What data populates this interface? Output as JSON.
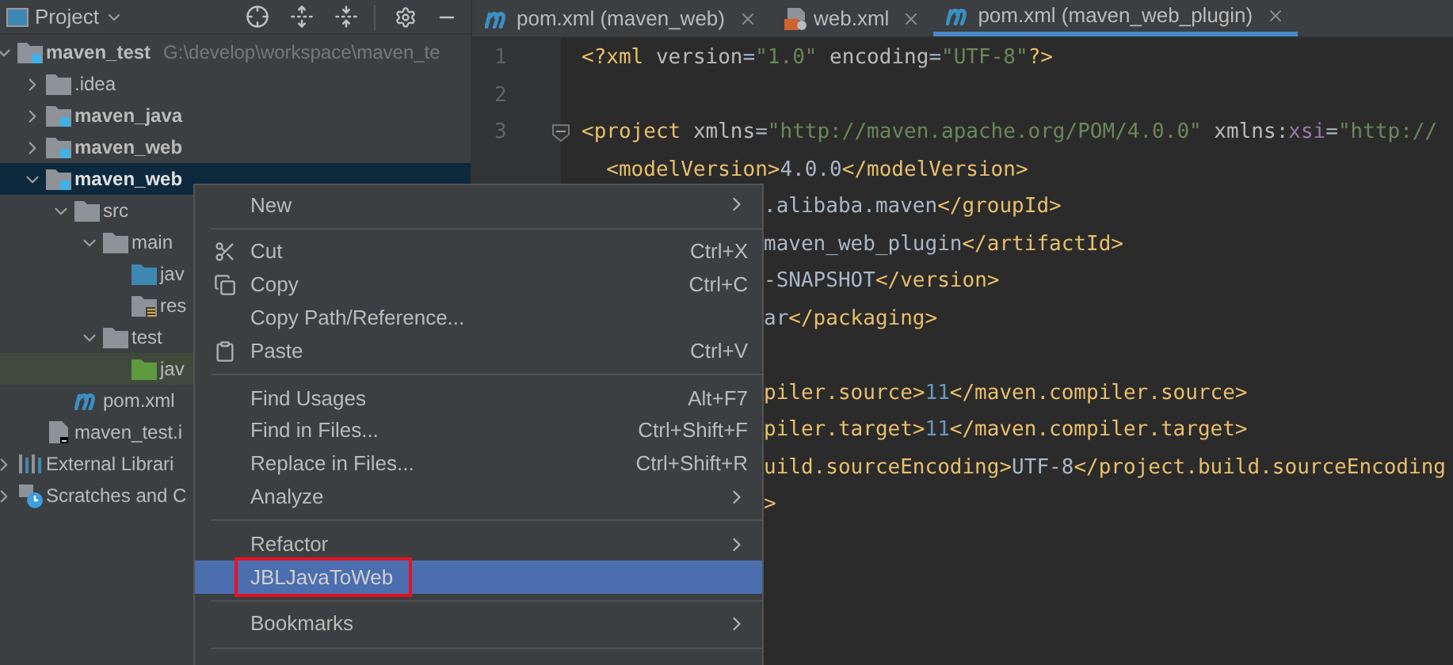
{
  "project_panel": {
    "title": "Project",
    "tree": [
      {
        "label": "maven_test",
        "kind": "module",
        "expanded": true,
        "selected": false,
        "path": "G:\\develop\\workspace\\maven_te",
        "children": [
          {
            "label": ".idea",
            "kind": "folder",
            "expanded": false,
            "selected": false
          },
          {
            "label": "maven_java",
            "kind": "module",
            "expanded": false,
            "selected": false
          },
          {
            "label": "maven_web",
            "kind": "module",
            "expanded": false,
            "selected": false
          },
          {
            "label": "maven_web",
            "kind": "module",
            "expanded": true,
            "selected": true,
            "children": [
              {
                "label": "src",
                "kind": "folder",
                "expanded": true,
                "selected": false,
                "children": [
                  {
                    "label": "main",
                    "kind": "folder",
                    "expanded": true,
                    "selected": false,
                    "children": [
                      {
                        "label": "jav",
                        "kind": "source-folder",
                        "selected": false
                      },
                      {
                        "label": "res",
                        "kind": "resources-folder",
                        "selected": false
                      }
                    ]
                  },
                  {
                    "label": "test",
                    "kind": "folder",
                    "expanded": true,
                    "selected": false,
                    "children": [
                      {
                        "label": "jav",
                        "kind": "test-folder",
                        "selected": false
                      }
                    ]
                  }
                ]
              },
              {
                "label": "pom.xml",
                "kind": "maven-file",
                "selected": false
              }
            ]
          },
          {
            "label": "maven_test.i",
            "kind": "file",
            "selected": false
          }
        ]
      },
      {
        "label": "External Librari",
        "kind": "libraries",
        "expanded": false,
        "selected": false
      },
      {
        "label": "Scratches and C",
        "kind": "scratches",
        "expanded": false,
        "selected": false
      }
    ]
  },
  "tabs": [
    {
      "label": "pom.xml (maven_web)",
      "kind": "maven-file",
      "selected": false
    },
    {
      "label": "web.xml",
      "kind": "xml-file",
      "selected": false
    },
    {
      "label": "pom.xml (maven_web_plugin)",
      "kind": "maven-file",
      "selected": true
    }
  ],
  "editor": {
    "lines": [
      {
        "kind": "code",
        "number": "1",
        "tokens": [
          {
            "text": "<?xml ",
            "kind": "tag"
          },
          {
            "text": "version",
            "kind": "attr"
          },
          {
            "text": "=",
            "kind": "text"
          },
          {
            "text": "\"1.0\"",
            "kind": "string"
          },
          {
            "text": " encoding",
            "kind": "attr"
          },
          {
            "text": "=",
            "kind": "text"
          },
          {
            "text": "\"UTF-8\"",
            "kind": "string"
          },
          {
            "text": "?>",
            "kind": "tag"
          }
        ]
      },
      {
        "kind": "blank",
        "number": "2"
      },
      {
        "kind": "code",
        "number": "3",
        "fold": true,
        "tokens": [
          {
            "text": "<project ",
            "kind": "tag"
          },
          {
            "text": "xmlns",
            "kind": "attr"
          },
          {
            "text": "=",
            "kind": "text"
          },
          {
            "text": "\"http://maven.apache.org/POM/4.0.0\"",
            "kind": "string"
          },
          {
            "text": " xmlns:",
            "kind": "attr"
          },
          {
            "text": "xsi",
            "kind": "ns"
          },
          {
            "text": "=",
            "kind": "text"
          },
          {
            "text": "\"http://",
            "kind": "string"
          }
        ]
      },
      {
        "kind": "code",
        "tokens": [
          {
            "text": "  <modelVersion>",
            "kind": "tag"
          },
          {
            "text": "4.0.0",
            "kind": "text"
          },
          {
            "text": "</modelVersion>",
            "kind": "tag"
          }
        ]
      },
      {
        "kind": "code",
        "partly_hidden": true,
        "tokens": [
          {
            "text": ".alibaba.maven",
            "kind": "text"
          },
          {
            "text": "</groupId>",
            "kind": "tag"
          }
        ]
      },
      {
        "kind": "code",
        "partly_hidden": true,
        "tokens": [
          {
            "text": "maven_web_plugin",
            "kind": "text"
          },
          {
            "text": "</artifactId>",
            "kind": "tag"
          }
        ]
      },
      {
        "kind": "code",
        "partly_hidden": true,
        "tokens": [
          {
            "text": "-SNAPSHOT",
            "kind": "text"
          },
          {
            "text": "</version>",
            "kind": "tag"
          }
        ]
      },
      {
        "kind": "code",
        "partly_hidden": true,
        "tokens": [
          {
            "text": "ar",
            "kind": "text"
          },
          {
            "text": "</packaging>",
            "kind": "tag"
          }
        ]
      },
      {
        "kind": "blank"
      },
      {
        "kind": "code",
        "partly_hidden": true,
        "tokens": [
          {
            "text": "piler.source>",
            "kind": "tag"
          },
          {
            "text": "11",
            "kind": "number"
          },
          {
            "text": "</maven.compiler.source>",
            "kind": "tag"
          }
        ]
      },
      {
        "kind": "code",
        "partly_hidden": true,
        "tokens": [
          {
            "text": "piler.target>",
            "kind": "tag"
          },
          {
            "text": "11",
            "kind": "number"
          },
          {
            "text": "</maven.compiler.target>",
            "kind": "tag"
          }
        ]
      },
      {
        "kind": "code",
        "partly_hidden": true,
        "tokens": [
          {
            "text": "uild.sourceEncoding>",
            "kind": "tag"
          },
          {
            "text": "UTF-8",
            "kind": "text"
          },
          {
            "text": "</project.build.sourceEncoding",
            "kind": "tag"
          }
        ]
      },
      {
        "kind": "code",
        "partly_hidden": true,
        "tokens": [
          {
            "text": ">",
            "kind": "tag"
          }
        ]
      }
    ]
  },
  "context_menu": {
    "items": [
      {
        "kind": "item",
        "label": "New",
        "submenu": true,
        "selected": false
      },
      {
        "kind": "separator"
      },
      {
        "kind": "cut",
        "label": "Cut",
        "shortcut": "Ctrl+X",
        "selected": false
      },
      {
        "kind": "copy",
        "label": "Copy",
        "shortcut": "Ctrl+C",
        "selected": false
      },
      {
        "kind": "item",
        "label": "Copy Path/Reference...",
        "selected": false
      },
      {
        "kind": "paste",
        "label": "Paste",
        "shortcut": "Ctrl+V",
        "selected": false
      },
      {
        "kind": "separator"
      },
      {
        "kind": "item",
        "label": "Find Usages",
        "shortcut": "Alt+F7",
        "selected": false
      },
      {
        "kind": "item",
        "label": "Find in Files...",
        "shortcut": "Ctrl+Shift+F",
        "selected": false
      },
      {
        "kind": "item",
        "label": "Replace in Files...",
        "shortcut": "Ctrl+Shift+R",
        "selected": false
      },
      {
        "kind": "item",
        "label": "Analyze",
        "submenu": true,
        "selected": false
      },
      {
        "kind": "separator"
      },
      {
        "kind": "item",
        "label": "Refactor",
        "submenu": true,
        "selected": false
      },
      {
        "kind": "item",
        "label": "JBLJavaToWeb",
        "selected": true,
        "outlined": true
      },
      {
        "kind": "separator"
      },
      {
        "kind": "item",
        "label": "Bookmarks",
        "submenu": true,
        "selected": false
      },
      {
        "kind": "separator"
      }
    ]
  }
}
